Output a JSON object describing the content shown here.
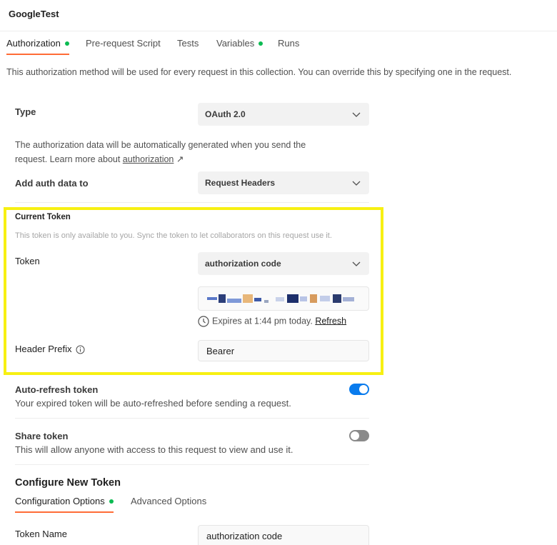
{
  "collection": {
    "name": "GoogleTest"
  },
  "tabs": [
    {
      "label": "Authorization",
      "dot": true,
      "active": true
    },
    {
      "label": "Pre-request Script",
      "dot": false
    },
    {
      "label": "Tests",
      "dot": false
    },
    {
      "label": "Variables",
      "dot": true
    },
    {
      "label": "Runs",
      "dot": false
    }
  ],
  "description": "This authorization method will be used for every request in this collection. You can override this by specifying one in the request.",
  "type": {
    "label": "Type",
    "value": "OAuth 2.0"
  },
  "auth_info": {
    "text": "The authorization data will be automatically generated when you send the request. Learn more about ",
    "link": "authorization",
    "link_arrow": "↗"
  },
  "add_auth": {
    "label": "Add auth data to",
    "value": "Request Headers"
  },
  "current_token": {
    "title": "Current Token",
    "note": "This token is only available to you. Sync the token to let collaborators on this request use it.",
    "token_label": "Token",
    "token_select": "authorization code",
    "expires_text": "Expires at 1:44 pm today.",
    "refresh_label": "Refresh",
    "header_prefix_label": "Header Prefix",
    "header_prefix_value": "Bearer"
  },
  "auto_refresh": {
    "title": "Auto-refresh token",
    "desc": "Your expired token will be auto-refreshed before sending a request.",
    "enabled": true
  },
  "share_token": {
    "title": "Share token",
    "desc": "This will allow anyone with access to this request to view and use it.",
    "enabled": false
  },
  "configure": {
    "title": "Configure New Token",
    "tabs": [
      {
        "label": "Configuration Options",
        "dot": true,
        "active": true
      },
      {
        "label": "Advanced Options",
        "dot": false
      }
    ],
    "token_name_label": "Token Name",
    "token_name_value": "authorization code"
  },
  "colors": {
    "accent": "#ff6c37",
    "dot": "#0cbb52",
    "toggle_on": "#097bed",
    "highlight": "#f7f012"
  }
}
